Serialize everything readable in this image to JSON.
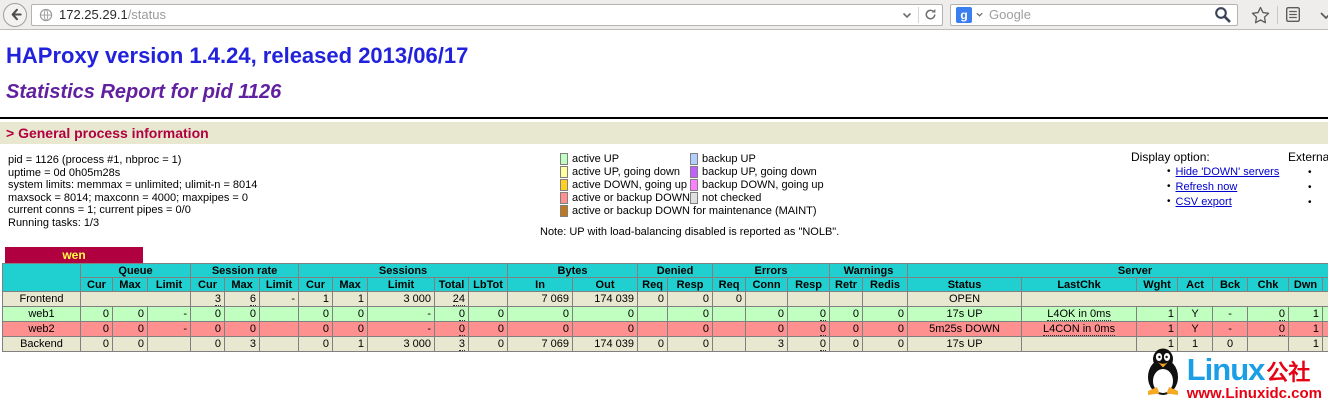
{
  "browser": {
    "url_host": "172.25.29.1",
    "url_path": "/status",
    "search_placeholder": "Google",
    "search_engine_initial": "g"
  },
  "header": {
    "title": "HAProxy version 1.4.24, released 2013/06/17",
    "subtitle": "Statistics Report for pid 1126"
  },
  "section": {
    "heading": "> General process information",
    "process_info": [
      "pid = 1126 (process #1, nbproc = 1)",
      "uptime = 0d 0h05m28s",
      "system limits: memmax = unlimited; ulimit-n = 8014",
      "maxsock = 8014; maxconn = 4000; maxpipes = 0",
      "current conns = 1; current pipes = 0/0",
      "Running tasks: 1/3"
    ],
    "legend_left": [
      {
        "label": "active UP",
        "color": "#c0ffc0"
      },
      {
        "label": "active UP, going down",
        "color": "#ffffa0"
      },
      {
        "label": "active DOWN, going up",
        "color": "#ffd020"
      },
      {
        "label": "active or backup DOWN",
        "color": "#ff9090"
      },
      {
        "label": "active or backup DOWN for maintenance (MAINT)",
        "color": "#c07820"
      }
    ],
    "legend_right": [
      {
        "label": "backup UP",
        "color": "#b0d0ff"
      },
      {
        "label": "backup UP, going down",
        "color": "#c060ff"
      },
      {
        "label": "backup DOWN, going up",
        "color": "#ff80ff"
      },
      {
        "label": "not checked",
        "color": "#e0e0e0"
      }
    ],
    "legend_note": "Note: UP with load-balancing disabled is reported as \"NOLB\".",
    "display_options_title": "Display option:",
    "display_options": [
      "Hide 'DOWN' servers",
      "Refresh now",
      "CSV export"
    ],
    "external_title": "External resources:"
  },
  "proxy": {
    "name": "wen",
    "header_groups": [
      {
        "label": "Queue",
        "span": 3
      },
      {
        "label": "Session rate",
        "span": 3
      },
      {
        "label": "Sessions",
        "span": 5
      },
      {
        "label": "Bytes",
        "span": 2
      },
      {
        "label": "Denied",
        "span": 2
      },
      {
        "label": "Errors",
        "span": 3
      },
      {
        "label": "Warnings",
        "span": 2
      },
      {
        "label": "Server",
        "span": 8
      }
    ],
    "sub_headers": [
      "Cur",
      "Max",
      "Limit",
      "Cur",
      "Max",
      "Limit",
      "Cur",
      "Max",
      "Limit",
      "Total",
      "LbTot",
      "In",
      "Out",
      "Req",
      "Resp",
      "Req",
      "Conn",
      "Resp",
      "Retr",
      "Redis",
      "Status",
      "LastChk",
      "Wght",
      "Act",
      "Bck",
      "Chk",
      "Dwn",
      ""
    ],
    "rows": [
      {
        "name": "Frontend",
        "state": "plain",
        "cells": [
          {
            "v": "",
            "s": 3
          },
          {
            "v": "3",
            "d": 1
          },
          {
            "v": "6",
            "d": 1
          },
          {
            "v": "-"
          },
          {
            "v": "1"
          },
          {
            "v": "1"
          },
          {
            "v": "3 000"
          },
          {
            "v": "24",
            "d": 1
          },
          {
            "v": ""
          },
          {
            "v": "7 069"
          },
          {
            "v": "174 039"
          },
          {
            "v": "0"
          },
          {
            "v": "0"
          },
          {
            "v": "0"
          },
          {
            "v": ""
          },
          {
            "v": ""
          },
          {
            "v": ""
          },
          {
            "v": ""
          },
          {
            "v": "OPEN",
            "a": "c"
          },
          {
            "v": "",
            "s": 7
          }
        ]
      },
      {
        "name": "web1",
        "state": "up",
        "cells": [
          {
            "v": "0"
          },
          {
            "v": "0"
          },
          {
            "v": "-"
          },
          {
            "v": "0"
          },
          {
            "v": "0"
          },
          {
            "v": ""
          },
          {
            "v": "0"
          },
          {
            "v": "0"
          },
          {
            "v": "-"
          },
          {
            "v": "0",
            "d": 1
          },
          {
            "v": "0"
          },
          {
            "v": "0"
          },
          {
            "v": "0"
          },
          {
            "v": ""
          },
          {
            "v": "0"
          },
          {
            "v": ""
          },
          {
            "v": "0"
          },
          {
            "v": "0",
            "d": 1
          },
          {
            "v": "0"
          },
          {
            "v": "0"
          },
          {
            "v": "17s UP",
            "a": "c"
          },
          {
            "v": "L4OK in 0ms",
            "a": "c",
            "d": 1
          },
          {
            "v": "1"
          },
          {
            "v": "Y",
            "a": "c"
          },
          {
            "v": "-",
            "a": "c"
          },
          {
            "v": "0",
            "d": 1
          },
          {
            "v": "1"
          },
          {
            "v": ""
          }
        ]
      },
      {
        "name": "web2",
        "state": "down",
        "cells": [
          {
            "v": "0"
          },
          {
            "v": "0"
          },
          {
            "v": "-"
          },
          {
            "v": "0"
          },
          {
            "v": "0"
          },
          {
            "v": ""
          },
          {
            "v": "0"
          },
          {
            "v": "0"
          },
          {
            "v": "-"
          },
          {
            "v": "0",
            "d": 1
          },
          {
            "v": "0"
          },
          {
            "v": "0"
          },
          {
            "v": "0"
          },
          {
            "v": ""
          },
          {
            "v": "0"
          },
          {
            "v": ""
          },
          {
            "v": "0"
          },
          {
            "v": "0",
            "d": 1
          },
          {
            "v": "0"
          },
          {
            "v": "0"
          },
          {
            "v": "5m25s DOWN",
            "a": "c"
          },
          {
            "v": "L4CON in 0ms",
            "a": "c",
            "d": 1
          },
          {
            "v": "1"
          },
          {
            "v": "Y",
            "a": "c"
          },
          {
            "v": "-",
            "a": "c"
          },
          {
            "v": "0",
            "d": 1
          },
          {
            "v": "1"
          },
          {
            "v": ""
          }
        ]
      },
      {
        "name": "Backend",
        "state": "plain",
        "cells": [
          {
            "v": "0"
          },
          {
            "v": "0"
          },
          {
            "v": ""
          },
          {
            "v": "0"
          },
          {
            "v": "3"
          },
          {
            "v": ""
          },
          {
            "v": "0"
          },
          {
            "v": "1"
          },
          {
            "v": "3 000"
          },
          {
            "v": "3",
            "d": 1
          },
          {
            "v": "0"
          },
          {
            "v": "7 069"
          },
          {
            "v": "174 039"
          },
          {
            "v": "0"
          },
          {
            "v": "0"
          },
          {
            "v": ""
          },
          {
            "v": "3"
          },
          {
            "v": "0",
            "d": 1
          },
          {
            "v": "0"
          },
          {
            "v": "0"
          },
          {
            "v": "17s UP",
            "a": "c"
          },
          {
            "v": ""
          },
          {
            "v": "1"
          },
          {
            "v": "1",
            "a": "c"
          },
          {
            "v": "0",
            "a": "c"
          },
          {
            "v": ""
          },
          {
            "v": "1"
          },
          {
            "v": ""
          }
        ]
      }
    ]
  },
  "watermark": {
    "brand": "Linux",
    "brand_suffix": "公社",
    "url": "www.Linuxidc.com"
  },
  "colors": {
    "table_header": "#20d0d0",
    "proxy_tab_bg": "#b00040",
    "proxy_tab_text": "#ffff40",
    "section_heading_bg": "#e8e8d0",
    "section_heading_text": "#b00040",
    "title_blue": "#2222dd",
    "subtitle_purple": "#6020a0",
    "link_blue": "#0000cc",
    "rows": {
      "plain": "#e8e8d0",
      "up": "#c0ffc0",
      "down": "#ff9090"
    },
    "brand_blue": "#1a9ee6",
    "brand_red": "#e60012"
  }
}
